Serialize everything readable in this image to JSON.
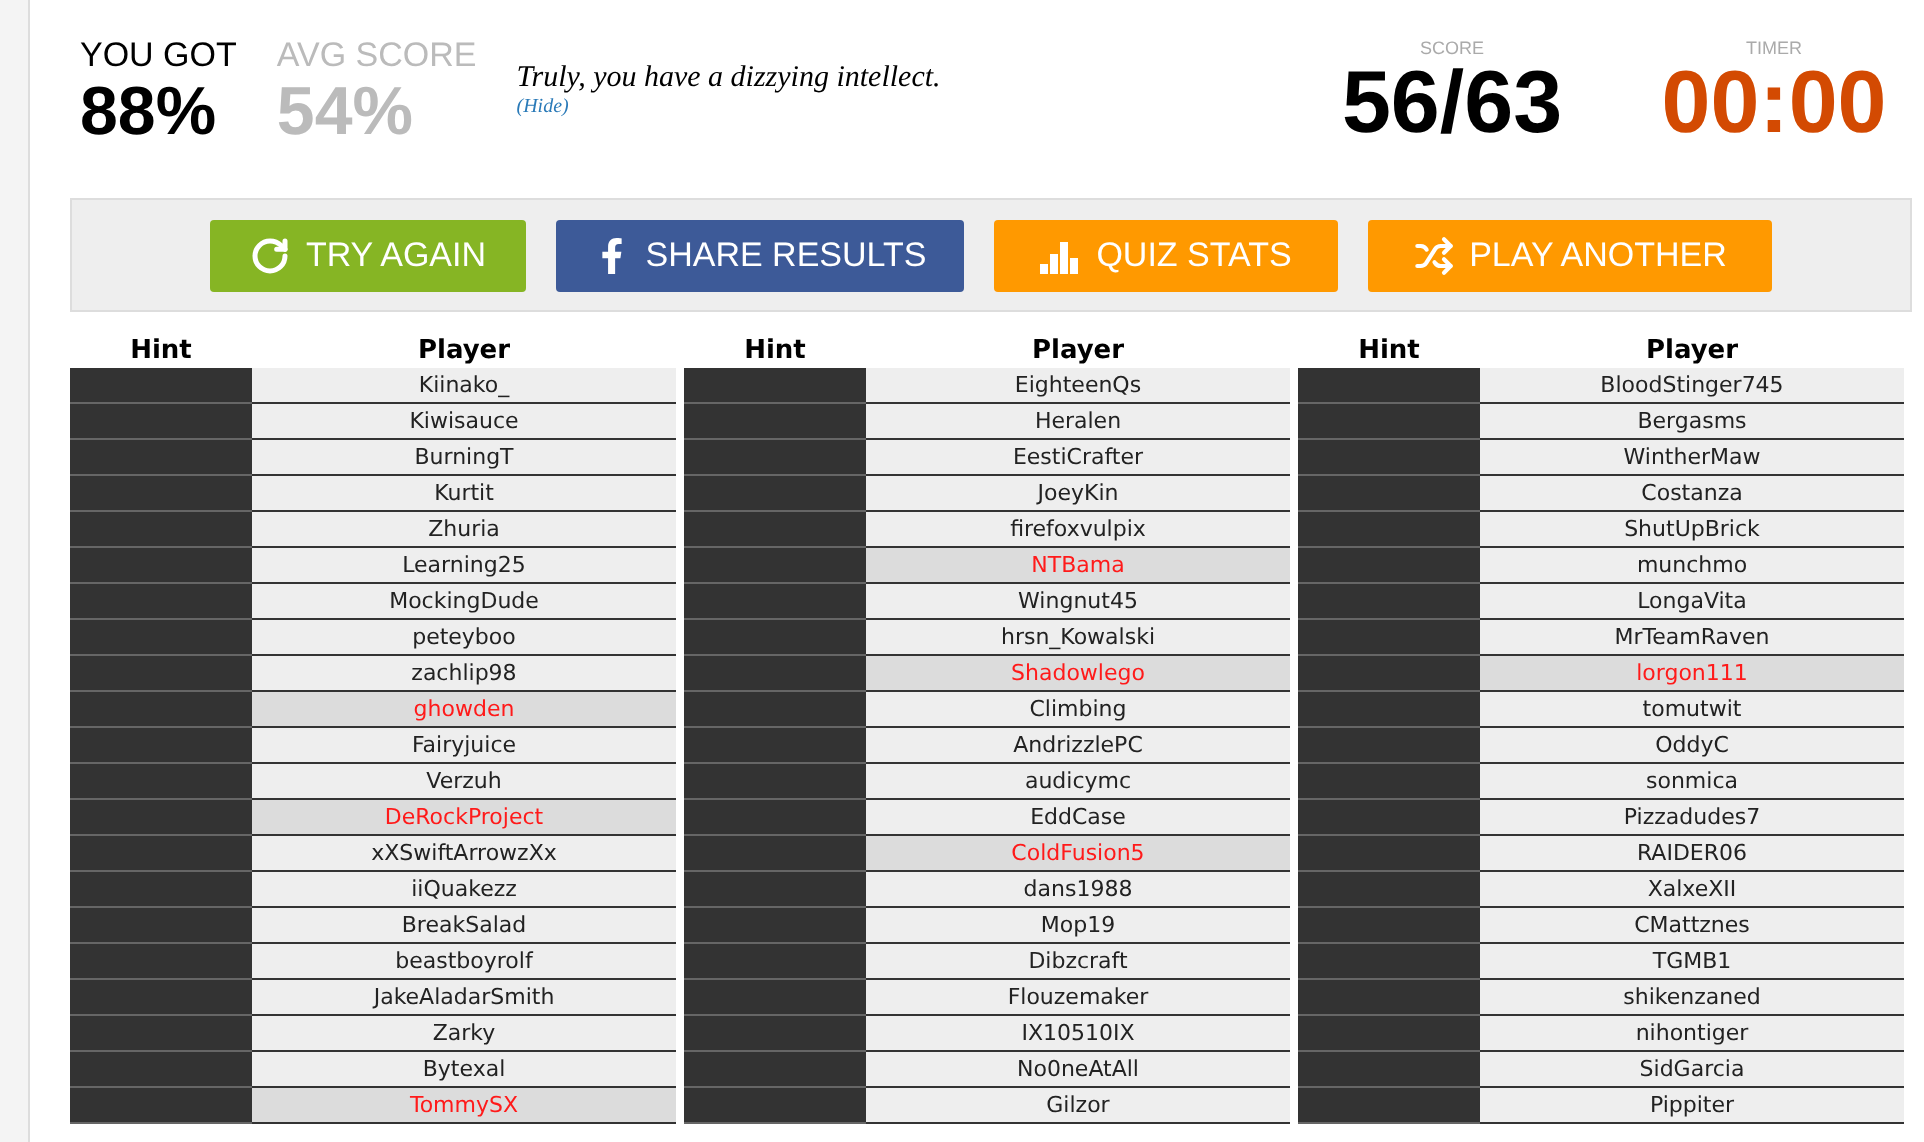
{
  "result": {
    "you_got_label": "YOU GOT",
    "you_got": "88%",
    "avg_label": "AVG SCORE",
    "avg": "54%",
    "message": "Truly, you have a dizzying intellect.",
    "hide_link": "(Hide)"
  },
  "score": {
    "label": "SCORE",
    "value": "56/63"
  },
  "timer": {
    "label": "TIMER",
    "value": "00:00"
  },
  "buttons": [
    {
      "kind": "retry",
      "label": "TRY AGAIN"
    },
    {
      "kind": "share",
      "label": "SHARE RESULTS"
    },
    {
      "kind": "stats",
      "label": "QUIZ STATS"
    },
    {
      "kind": "shuffle",
      "label": "PLAY ANOTHER"
    }
  ],
  "tables": [
    {
      "columns": [
        "Hint",
        "Player"
      ],
      "rows": [
        {
          "player": "Kiinako_",
          "missed": false
        },
        {
          "player": "Kiwisauce",
          "missed": false
        },
        {
          "player": "BurningT",
          "missed": false
        },
        {
          "player": "Kurtit",
          "missed": false
        },
        {
          "player": "Zhuria",
          "missed": false
        },
        {
          "player": "Learning25",
          "missed": false
        },
        {
          "player": "MockingDude",
          "missed": false
        },
        {
          "player": "peteyboo",
          "missed": false
        },
        {
          "player": "zachlip98",
          "missed": false
        },
        {
          "player": "ghowden",
          "missed": true
        },
        {
          "player": "Fairyjuice",
          "missed": false
        },
        {
          "player": "Verzuh",
          "missed": false
        },
        {
          "player": "DeRockProject",
          "missed": true
        },
        {
          "player": "xXSwiftArrowzXx",
          "missed": false
        },
        {
          "player": "iiQuakezz",
          "missed": false
        },
        {
          "player": "BreakSalad",
          "missed": false
        },
        {
          "player": "beastboyrolf",
          "missed": false
        },
        {
          "player": "JakeAladarSmith",
          "missed": false
        },
        {
          "player": "Zarky",
          "missed": false
        },
        {
          "player": "Bytexal",
          "missed": false
        },
        {
          "player": "TommySX",
          "missed": true
        }
      ]
    },
    {
      "columns": [
        "Hint",
        "Player"
      ],
      "rows": [
        {
          "player": "EighteenQs",
          "missed": false
        },
        {
          "player": "Heralen",
          "missed": false
        },
        {
          "player": "EestiCrafter",
          "missed": false
        },
        {
          "player": "JoeyKin",
          "missed": false
        },
        {
          "player": "firefoxvulpix",
          "missed": false
        },
        {
          "player": "NTBama",
          "missed": true
        },
        {
          "player": "Wingnut45",
          "missed": false
        },
        {
          "player": "hrsn_Kowalski",
          "missed": false
        },
        {
          "player": "Shadowlego",
          "missed": true
        },
        {
          "player": "Climbing",
          "missed": false
        },
        {
          "player": "AndrizzlePC",
          "missed": false
        },
        {
          "player": "audicymc",
          "missed": false
        },
        {
          "player": "EddCase",
          "missed": false
        },
        {
          "player": "ColdFusion5",
          "missed": true
        },
        {
          "player": "dans1988",
          "missed": false
        },
        {
          "player": "Mop19",
          "missed": false
        },
        {
          "player": "Dibzcraft",
          "missed": false
        },
        {
          "player": "Flouzemaker",
          "missed": false
        },
        {
          "player": "IX10510IX",
          "missed": false
        },
        {
          "player": "No0neAtAll",
          "missed": false
        },
        {
          "player": "Gilzor",
          "missed": false
        }
      ]
    },
    {
      "columns": [
        "Hint",
        "Player"
      ],
      "rows": [
        {
          "player": "BloodStinger745",
          "missed": false
        },
        {
          "player": "Bergasms",
          "missed": false
        },
        {
          "player": "WintherMaw",
          "missed": false
        },
        {
          "player": "Costanza",
          "missed": false
        },
        {
          "player": "ShutUpBrick",
          "missed": false
        },
        {
          "player": "munchmo",
          "missed": false
        },
        {
          "player": "LongaVita",
          "missed": false
        },
        {
          "player": "MrTeamRaven",
          "missed": false
        },
        {
          "player": "lorgon111",
          "missed": true
        },
        {
          "player": "tomutwit",
          "missed": false
        },
        {
          "player": "OddyC",
          "missed": false
        },
        {
          "player": "sonmica",
          "missed": false
        },
        {
          "player": "Pizzadudes7",
          "missed": false
        },
        {
          "player": "RAIDER06",
          "missed": false
        },
        {
          "player": "XalxeXII",
          "missed": false
        },
        {
          "player": "CMattznes",
          "missed": false
        },
        {
          "player": "TGMB1",
          "missed": false
        },
        {
          "player": "shikenzaned",
          "missed": false
        },
        {
          "player": "nihontiger",
          "missed": false
        },
        {
          "player": "SidGarcia",
          "missed": false
        },
        {
          "player": "Pippiter",
          "missed": false
        }
      ]
    }
  ]
}
